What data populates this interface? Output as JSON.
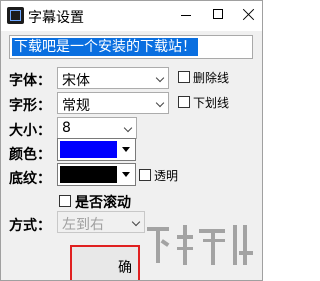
{
  "window": {
    "title": "字幕设置"
  },
  "preview": {
    "text": "下载吧是一个安装的下载站！"
  },
  "font": {
    "label": "字体：",
    "value": "宋体",
    "strikethrough_label": "删除线"
  },
  "style": {
    "label": "字形：",
    "value": "常规",
    "underline_label": "下划线"
  },
  "size": {
    "label": "大小：",
    "value": "8"
  },
  "color": {
    "label": "颜色：",
    "value": "#0000ff"
  },
  "background": {
    "label": "底纹：",
    "value": "#000000",
    "transparent_label": "透明"
  },
  "scroll": {
    "label": "是否滚动"
  },
  "direction": {
    "label": "方式：",
    "value": "左到右"
  },
  "buttons": {
    "ok_label": "确"
  },
  "watermark": {
    "text": "下载"
  }
}
